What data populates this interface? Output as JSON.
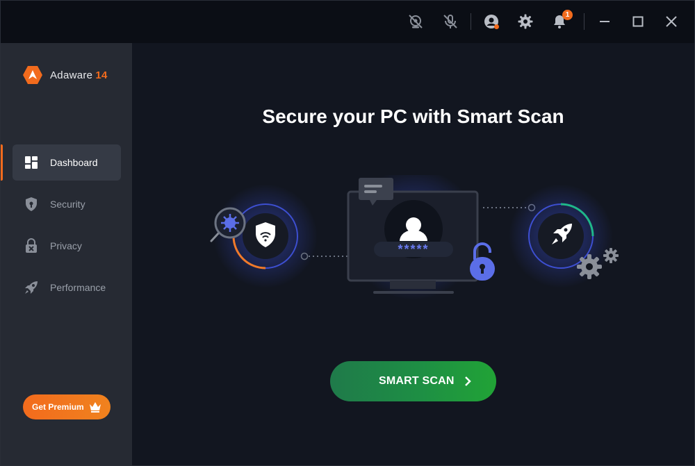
{
  "app": {
    "name": "Adaware",
    "version": "14"
  },
  "titlebar": {
    "icons": [
      "webcam-off-icon",
      "mic-off-icon",
      "account-icon",
      "settings-gear-icon",
      "notifications-bell-icon",
      "minimize-icon",
      "maximize-icon",
      "close-icon"
    ],
    "notification_count": "1"
  },
  "sidebar": {
    "items": [
      {
        "label": "Dashboard",
        "icon": "dashboard-grid-icon",
        "active": true
      },
      {
        "label": "Security",
        "icon": "shield-lock-icon",
        "active": false
      },
      {
        "label": "Privacy",
        "icon": "privacy-lock-x-icon",
        "active": false
      },
      {
        "label": "Performance",
        "icon": "rocket-icon",
        "active": false
      }
    ],
    "premium_label": "Get Premium"
  },
  "main": {
    "headline": "Secure your PC with Smart Scan",
    "password_mask": "*****",
    "scan_button_label": "SMART SCAN"
  },
  "colors": {
    "accent_orange": "#f26b1d",
    "scan_green": "#21a336",
    "glow_blue": "#3a4fd8"
  }
}
